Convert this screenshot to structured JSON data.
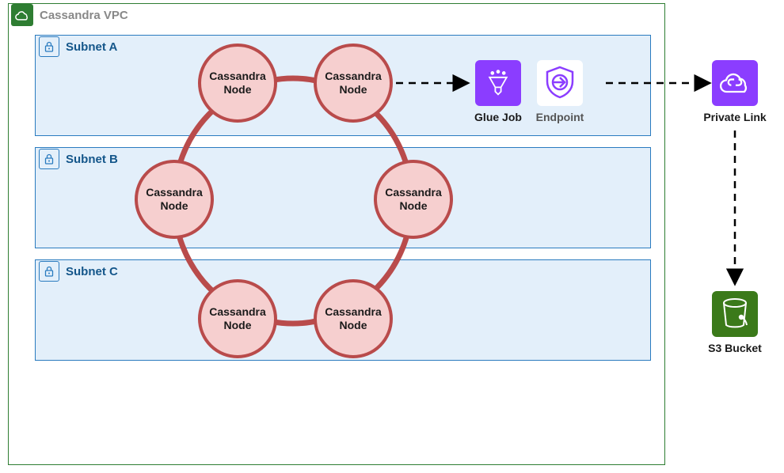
{
  "vpc": {
    "title": "Cassandra VPC"
  },
  "subnets": {
    "a": {
      "label": "Subnet A"
    },
    "b": {
      "label": "Subnet B"
    },
    "c": {
      "label": "Subnet C"
    }
  },
  "node_label": "Cassandra Node",
  "services": {
    "glue": {
      "label": "Glue Job"
    },
    "endpoint": {
      "label": "Endpoint"
    },
    "privatelink": {
      "label": "Private Link"
    },
    "s3": {
      "label": "S3 Bucket"
    }
  },
  "diagram": {
    "ring_nodes": 6,
    "flow": [
      "Cassandra Node",
      "Glue Job",
      "Endpoint",
      "Private Link",
      "S3 Bucket"
    ]
  }
}
